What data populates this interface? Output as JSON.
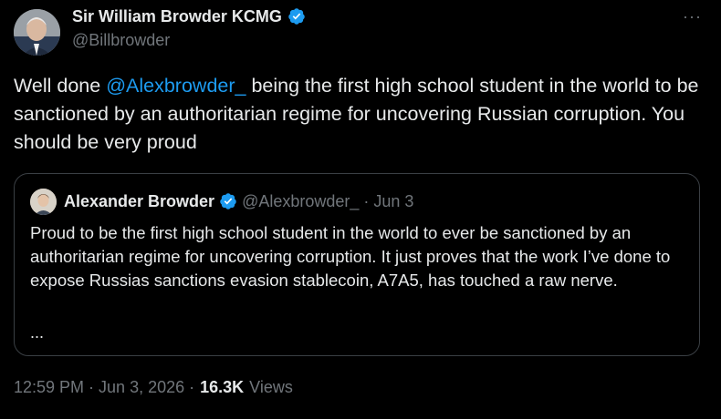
{
  "author": {
    "display_name": "Sir William Browder KCMG",
    "handle": "@Billbrowder"
  },
  "more_label": "···",
  "tweet": {
    "text_before": "Well done ",
    "mention": "@Alexbrowder_",
    "text_after": " being the first high school student in the world to be sanctioned by an authoritarian regime for uncovering Russian corruption. You should be very proud"
  },
  "quote": {
    "display_name": "Alexander Browder",
    "handle": "@Alexbrowder_",
    "separator": "·",
    "date": "Jun 3",
    "text": "Proud to be the first high school student in the world to ever be sanctioned by an authoritarian regime for uncovering corruption. It just proves that the work I’ve done to expose Russias sanctions evasion stablecoin, A7A5, has touched a raw nerve.",
    "ellipsis": "..."
  },
  "meta": {
    "time_date": "12:59 PM · Jun 3, 2026 ·",
    "views_count": "16.3K",
    "views_label": "Views"
  },
  "colors": {
    "background": "#000000",
    "text": "#e7e9ea",
    "secondary": "#71767b",
    "accent": "#1d9bf0",
    "border": "#3a3f44"
  },
  "icons": {
    "verified": "verified-badge-icon",
    "more": "more-horizontal-icon"
  }
}
